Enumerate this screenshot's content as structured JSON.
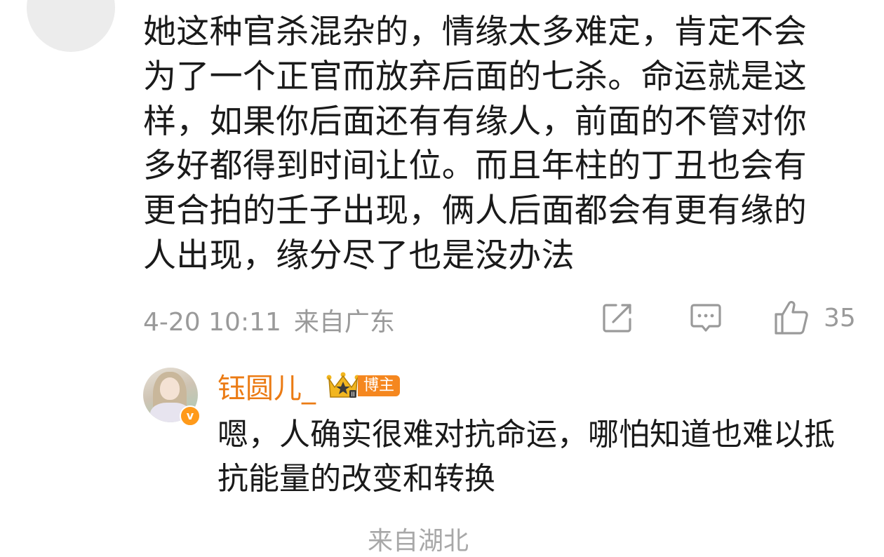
{
  "comment": {
    "avatar_icon": "avatar-placeholder-icon",
    "text": "她这种官杀混杂的，情缘太多难定，肯定不会为了一个正官而放弃后面的七杀。命运就是这样，如果你后面还有有缘人，前面的不管对你多好都得到时间让位。而且年柱的丁丑也会有更合拍的壬子出现，俩人后面都会有更有缘的人出现，缘分尽了也是没办法",
    "timestamp": "4-20 10:11",
    "location": "来自广东",
    "actions": {
      "share_icon": "share-edit-icon",
      "comment_icon": "comment-icon",
      "like_icon": "thumbs-up-icon",
      "like_count": "35"
    }
  },
  "reply": {
    "avatar_icon": "user-avatar",
    "verified_icon": "verified-v-icon",
    "verified_mark": "v",
    "username": "钰圆儿_",
    "crown_icon": "crown-level-icon",
    "badge_label": "博主",
    "text": "嗯，人确实很难对抗命运，哪怕知道也难以抵抗能量的改变和转换"
  },
  "next_row": {
    "location_partial": "来自湖北"
  },
  "colors": {
    "text": "#1a1a1a",
    "meta": "#9a9a9a",
    "username": "#eb7b14",
    "badge": "#f5871f",
    "crown": "#f2b61f"
  }
}
